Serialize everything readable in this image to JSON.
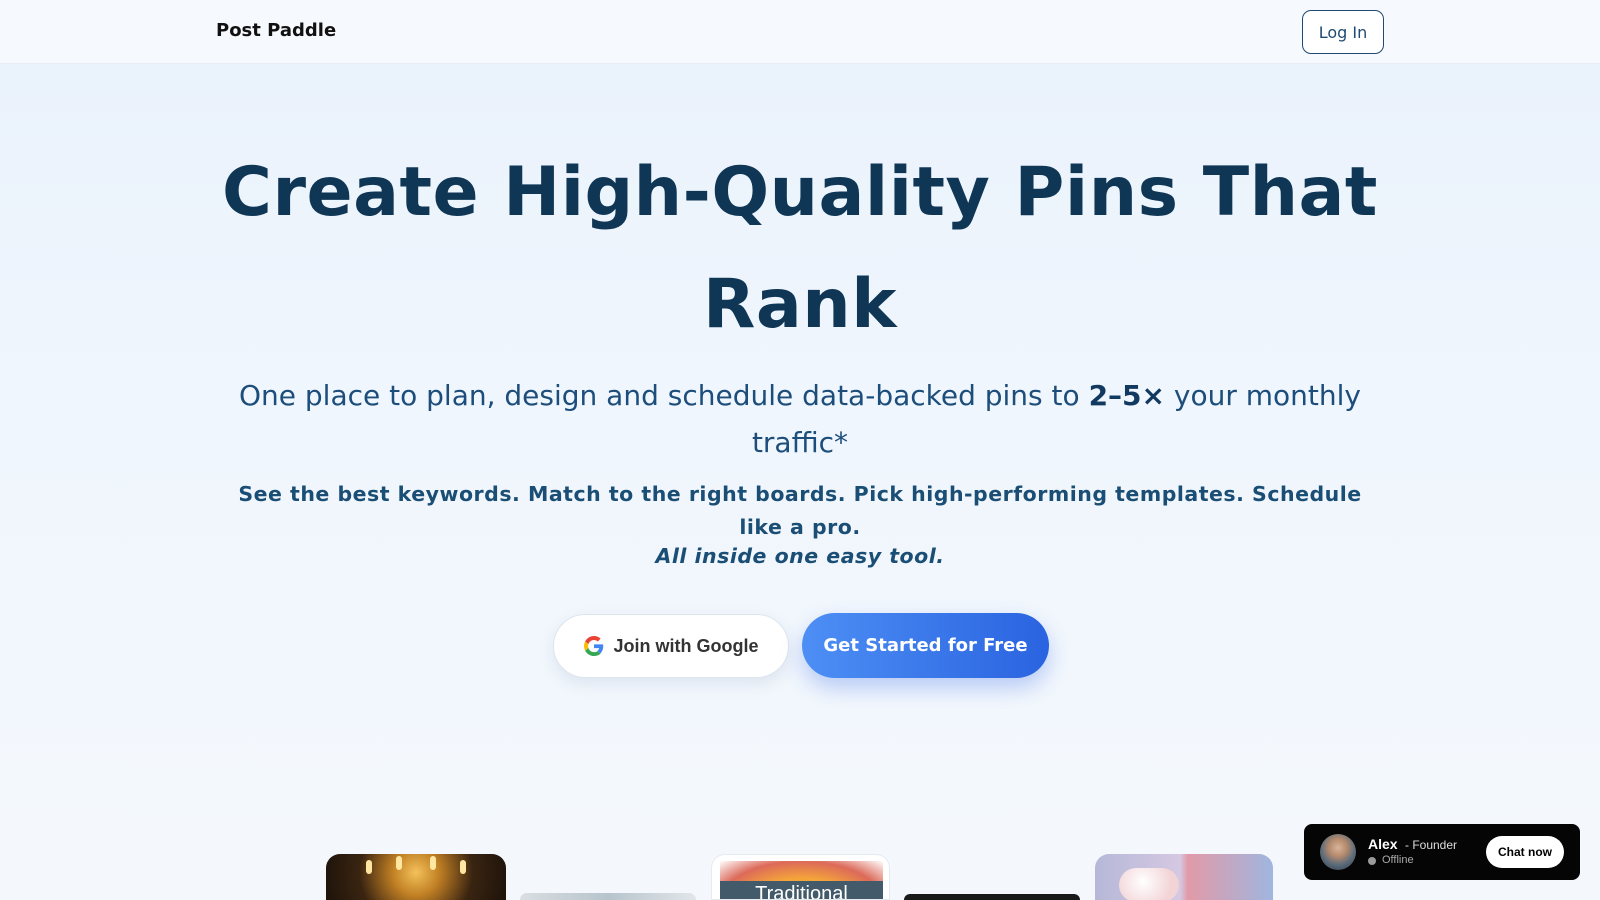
{
  "header": {
    "brand": "Post Paddle",
    "login_label": "Log In"
  },
  "hero": {
    "title_line1": "Create High-Quality Pins That",
    "title_line2": "Rank",
    "subtitle_pre": "One place to plan, design and schedule data-backed pins to ",
    "subtitle_bold": "2–5×",
    "subtitle_post": " your monthly traffic*",
    "features": "See the best keywords. Match to the right boards. Pick high-performing templates. Schedule like a pro.",
    "tagline": "All inside one easy tool.",
    "google_button": "Join with Google",
    "start_button": "Get Started for Free"
  },
  "pins": {
    "pin3_label": "Traditional"
  },
  "chat": {
    "name": "Alex",
    "role": "- Founder",
    "status": "Offline",
    "button": "Chat now"
  },
  "colors": {
    "accent": "#2a63e0",
    "heading": "#0f3655",
    "text": "#1d4e7b"
  }
}
